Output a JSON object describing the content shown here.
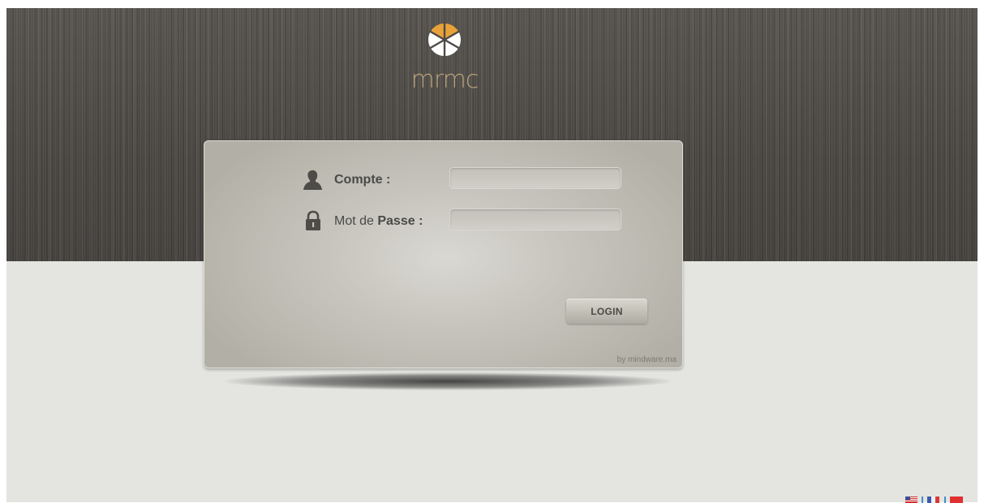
{
  "brand": {
    "logo_text": "mrmc",
    "logo_icon": "pinwheel-logo-icon",
    "colors": {
      "logo_orange": "#e8a23a",
      "logo_text": "#b9a27a"
    }
  },
  "login_form": {
    "account": {
      "label": "Compte :",
      "icon": "user-silhouette-icon",
      "value": "",
      "placeholder": ""
    },
    "password": {
      "label_prefix": "Mot de ",
      "label_bold": "Passe",
      "label_suffix": " :",
      "icon": "padlock-icon",
      "value": "",
      "placeholder": ""
    },
    "submit_label": "LOGIN",
    "credit": "by mindware.ma"
  },
  "languages": [
    {
      "name": "english-flag-icon",
      "separator": "|"
    },
    {
      "name": "french-flag-icon",
      "separator": "|"
    },
    {
      "name": "moroccan-flag-icon"
    }
  ],
  "theme": {
    "top_band": "#4c4945",
    "page_bg": "#e4e4e1",
    "panel_bg": "#c6c4bc",
    "separator_color": "#3f8fc9"
  }
}
